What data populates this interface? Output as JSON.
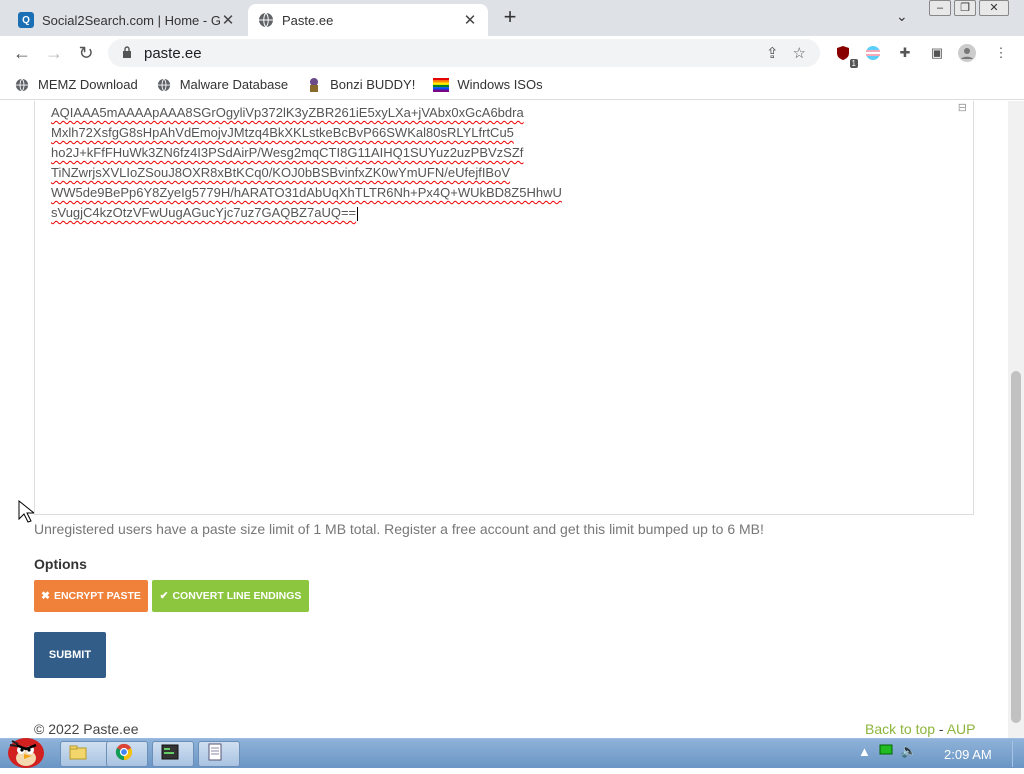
{
  "tabs": [
    {
      "title": "Social2Search.com | Home - G",
      "favicon": "q-icon"
    },
    {
      "title": "Paste.ee",
      "favicon": "globe-icon"
    }
  ],
  "address": "paste.ee",
  "bookmarks": [
    {
      "label": "MEMZ Download",
      "icon": "globe-icon"
    },
    {
      "label": "Malware Database",
      "icon": "globe-icon"
    },
    {
      "label": "Bonzi BUDDY!",
      "icon": "bonzi-icon"
    },
    {
      "label": "Windows ISOs",
      "icon": "rainbow-flag-icon"
    }
  ],
  "editor": {
    "lines": [
      "AQIAAA5mAAAApAAA8SGrOgyliVp372lK3yZBR261iE5xyLXa+jVAbx0xGcA6bdra",
      "Mxlh72XsfgG8sHpAhVdEmojvJMtzq4BkXKLstkeBcBvP66SWKal80sRLYLfrtCu5",
      "ho2J+kFfFHuWk3ZN6fz4I3PSdAirP/Wesg2mqCTI8G11AIHQ1SUYuz2uzPBVzSZf",
      "TiNZwrjsXVLIoZSouJ8OXR8xBtKCq0/KOJ0bBSBvinfxZK0wYmUFN/eUfejfIBoV",
      "WW5de9BePp6Y8ZyeIg5779H/hARATO31dAbUqXhTLTR6Nh+Px4Q+WUkBD8Z5HhwU",
      "sVugjC4kzOtzVFwUugAGucYjc7uz7GAQBZ7aUQ=="
    ]
  },
  "notice": "Unregistered users have a paste size limit of 1 MB total. Register a free account and get this limit bumped up to 6 MB!",
  "options_heading": "Options",
  "buttons": {
    "encrypt": "ENCRYPT PASTE",
    "convert": "CONVERT LINE ENDINGS",
    "submit": "SUBMIT"
  },
  "footer": {
    "copyright": "© 2022 Paste.ee",
    "back_to_top": "Back to top",
    "separator": " - ",
    "aup": "AUP"
  },
  "taskbar": {
    "clock": "2:09 AM"
  },
  "extension_badge": "1",
  "colors": {
    "encrypt": "#f0813a",
    "convert": "#8cc63f",
    "submit": "#325d88",
    "link": "#8cb53c"
  }
}
